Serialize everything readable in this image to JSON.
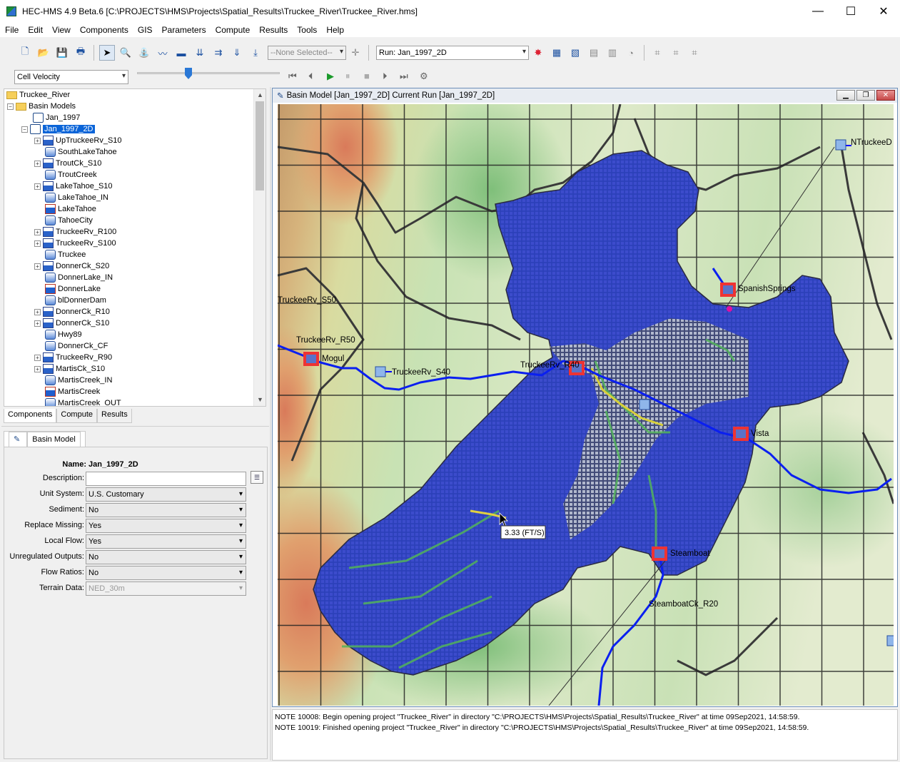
{
  "window": {
    "title": "HEC-HMS 4.9 Beta.6 [C:\\PROJECTS\\HMS\\Projects\\Spatial_Results\\Truckee_River\\Truckee_River.hms]",
    "minimize": "—",
    "maximize": "☐",
    "close": "✕"
  },
  "menu": [
    "File",
    "Edit",
    "View",
    "Components",
    "GIS",
    "Parameters",
    "Compute",
    "Results",
    "Tools",
    "Help"
  ],
  "toolbar": {
    "element_select": "--None Selected--",
    "run_select": "Run: Jan_1997_2D",
    "display_select": "Cell Velocity"
  },
  "tree": {
    "root": "Truckee_River",
    "basin_models_label": "Basin Models",
    "basin_1": "Jan_1997",
    "basin_2": "Jan_1997_2D",
    "elements": [
      {
        "name": "UpTruckeeRv_S10",
        "type": "sub",
        "exp": true
      },
      {
        "name": "SouthLakeTahoe",
        "type": "jun",
        "exp": false
      },
      {
        "name": "TroutCk_S10",
        "type": "sub",
        "exp": true
      },
      {
        "name": "TroutCreek",
        "type": "jun",
        "exp": false
      },
      {
        "name": "LakeTahoe_S10",
        "type": "sub",
        "exp": true
      },
      {
        "name": "LakeTahoe_IN",
        "type": "jun",
        "exp": false
      },
      {
        "name": "LakeTahoe",
        "type": "res",
        "exp": false
      },
      {
        "name": "TahoeCity",
        "type": "jun",
        "exp": false
      },
      {
        "name": "TruckeeRv_R100",
        "type": "sub",
        "exp": true
      },
      {
        "name": "TruckeeRv_S100",
        "type": "sub",
        "exp": true
      },
      {
        "name": "Truckee",
        "type": "jun",
        "exp": false
      },
      {
        "name": "DonnerCk_S20",
        "type": "sub",
        "exp": true
      },
      {
        "name": "DonnerLake_IN",
        "type": "jun",
        "exp": false
      },
      {
        "name": "DonnerLake",
        "type": "res",
        "exp": false
      },
      {
        "name": "blDonnerDam",
        "type": "jun",
        "exp": false
      },
      {
        "name": "DonnerCk_R10",
        "type": "sub",
        "exp": true
      },
      {
        "name": "DonnerCk_S10",
        "type": "sub",
        "exp": true
      },
      {
        "name": "Hwy89",
        "type": "jun",
        "exp": false
      },
      {
        "name": "DonnerCk_CF",
        "type": "jun",
        "exp": false
      },
      {
        "name": "TruckeeRv_R90",
        "type": "sub",
        "exp": true
      },
      {
        "name": "MartisCk_S10",
        "type": "sub",
        "exp": true
      },
      {
        "name": "MartisCreek_IN",
        "type": "jun",
        "exp": false
      },
      {
        "name": "MartisCreek",
        "type": "res",
        "exp": false
      },
      {
        "name": "MartisCreek_OUT",
        "type": "jun",
        "exp": false
      }
    ]
  },
  "tabs": [
    "Components",
    "Compute",
    "Results"
  ],
  "props": {
    "tab": "Basin Model",
    "name_label": "Name:",
    "name_value": "Jan_1997_2D",
    "fields": [
      {
        "label": "Description:",
        "value": "",
        "kind": "text"
      },
      {
        "label": "Unit System:",
        "value": "U.S. Customary",
        "kind": "select"
      },
      {
        "label": "Sediment:",
        "value": "No",
        "kind": "select"
      },
      {
        "label": "Replace Missing:",
        "value": "Yes",
        "kind": "select"
      },
      {
        "label": "Local Flow:",
        "value": "Yes",
        "kind": "select"
      },
      {
        "label": "Unregulated Outputs:",
        "value": "No",
        "kind": "select"
      },
      {
        "label": "Flow Ratios:",
        "value": "No",
        "kind": "select"
      },
      {
        "label": "Terrain Data:",
        "value": "NED_30m",
        "kind": "disabled"
      }
    ]
  },
  "map": {
    "title": "Basin Model [Jan_1997_2D] Current Run [Jan_1997_2D]",
    "labels": {
      "ntruckee": "NTruckeeD",
      "spanish": "SpanishSprings",
      "truckee_s50": "TruckeeRv_S50",
      "truckee_r50": "TruckeeRv_R50",
      "mogul": "Mogul",
      "truckee_s40": "TruckeeRv_S40",
      "truckee_r40": "TruckeeRv_R40",
      "vista": "Vista",
      "steamboat": "Steamboat",
      "steamboat_r20": "SteamboatCk_R20",
      "tooltip": "3.33 (FT/S)"
    }
  },
  "messages": [
    "NOTE 10008:  Begin opening project \"Truckee_River\" in directory \"C:\\PROJECTS\\HMS\\Projects\\Spatial_Results\\Truckee_River\" at time 09Sep2021, 14:58:59.",
    "NOTE 10019:  Finished opening project \"Truckee_River\" in directory \"C:\\PROJECTS\\HMS\\Projects\\Spatial_Results\\Truckee_River\" at time 09Sep2021, 14:58:59."
  ],
  "colors": {
    "accent": "#0a64d8",
    "grid_cells": "#2a3fbf",
    "river": "#0a1ff0",
    "subbasin_outline": "#3a3a3a"
  }
}
